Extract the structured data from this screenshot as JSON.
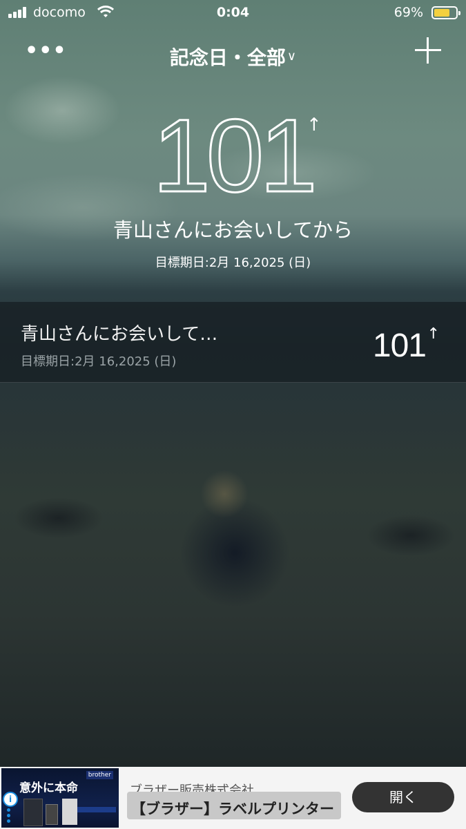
{
  "status_bar": {
    "carrier": "docomo",
    "time": "0:04",
    "battery_percent": "69%",
    "battery_level": 0.69,
    "battery_color": "#f4d03f"
  },
  "nav": {
    "title": "記念日・全部",
    "more_icon": "more-icon",
    "dropdown_icon": "chevron-down-icon",
    "add_icon": "plus-icon"
  },
  "hero": {
    "count": "101",
    "arrow": "↑",
    "title": "青山さんにお会いしてから",
    "target_date": "目標期日:2月 16,2025 (日)"
  },
  "list": {
    "items": [
      {
        "title": "青山さんにお会いして…",
        "target_date": "目標期日:2月 16,2025 (日)",
        "count": "101",
        "arrow": "↑"
      }
    ]
  },
  "ad": {
    "image_text": "意外に本命",
    "image_brand": "brother",
    "info_icon": "info-icon",
    "advertiser": "ブラザー販売株式会社",
    "headline": "【ブラザー】ラベルプリンター",
    "cta": "開く"
  }
}
